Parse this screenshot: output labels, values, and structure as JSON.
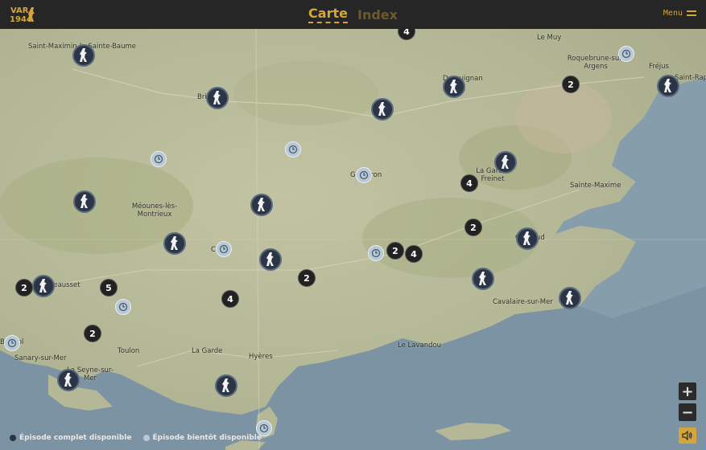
{
  "header": {
    "logo_top": "VAR",
    "logo_bottom": "1944",
    "tabs": [
      {
        "label": "Carte",
        "active": true
      },
      {
        "label": "Index",
        "active": false
      }
    ],
    "menu_label": "Menu"
  },
  "colors": {
    "accent": "#d4a63a",
    "header_bg": "#262626",
    "land": "#b9bc99",
    "sea": "#7c93a3",
    "marker_bg": "#2b3546",
    "soon_bg": "#b8c8d6"
  },
  "places": [
    "Saint-Maximin-la-Sainte-Baume",
    "Brignoles",
    "Le Muy",
    "Roquebrune-sur-Argens",
    "Fréjus",
    "Saint-Raphaël",
    "Draguignan",
    "Gonfaron",
    "La Garde-Freinet",
    "Sainte-Maxime",
    "Méounes-lès-Montrieux",
    "Cuers",
    "Grimaud",
    "Cavalaire-sur-Mer",
    "Toulon",
    "La Garde",
    "Hyères",
    "Le Lavandou",
    "Sanary-sur-Mer",
    "La Seyne-sur-Mer",
    "Le Beausset",
    "Bandol"
  ],
  "clusters": [
    "4",
    "2",
    "4",
    "2",
    "2",
    "4",
    "2",
    "2",
    "5",
    "4",
    "2"
  ],
  "legend": {
    "complete": "Épisode complet disponible",
    "soon": "Épisode bientôt disponible"
  },
  "controls": {
    "zoom_in": "+",
    "zoom_out": "−",
    "sound_icon": "speaker-icon"
  }
}
